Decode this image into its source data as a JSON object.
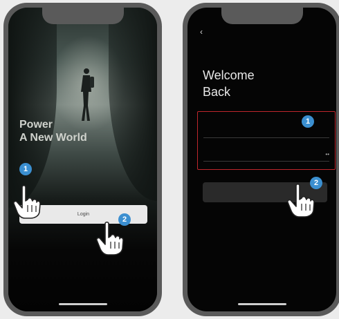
{
  "left_screen": {
    "status_time": "",
    "status_icons": "",
    "kicker": "",
    "headline_line1": "Power",
    "headline_line2": "A New World",
    "terms_text": "",
    "login_button": "Login",
    "step1_badge": "1",
    "step2_badge": "2"
  },
  "right_screen": {
    "status_time": "",
    "status_icons": "",
    "back_icon": "chevron-left-icon",
    "greeting_small": "",
    "title_line1": "Welcome",
    "title_line2": "Back",
    "email_placeholder": "",
    "password_placeholder": "",
    "password_reveal": "••",
    "login_button": "",
    "step1_badge": "1",
    "step2_badge": "2"
  },
  "colors": {
    "highlight_border": "#c0262c",
    "badge": "#3b8fd0",
    "phone_frame": "#5a5a5a"
  }
}
